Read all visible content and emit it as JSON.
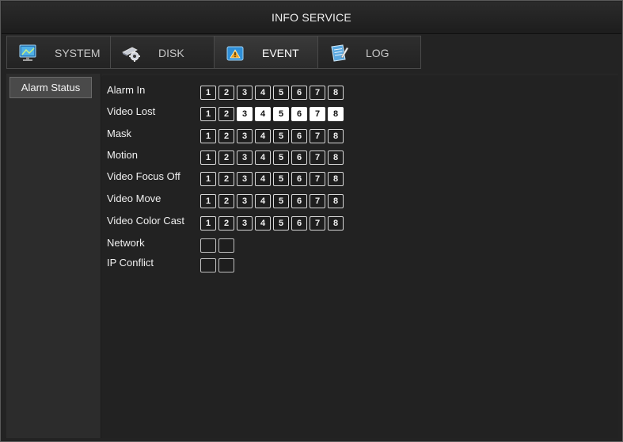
{
  "window": {
    "title": "INFO SERVICE"
  },
  "tabs": [
    {
      "label": "SYSTEM",
      "icon": "monitor-icon",
      "active": false
    },
    {
      "label": "DISK",
      "icon": "disk-gear-icon",
      "active": false
    },
    {
      "label": "EVENT",
      "icon": "warning-icon",
      "active": true
    },
    {
      "label": "LOG",
      "icon": "notepad-icon",
      "active": false
    }
  ],
  "sidebar": {
    "items": [
      {
        "label": "Alarm Status",
        "selected": true
      }
    ]
  },
  "alarm_status": {
    "rows": [
      {
        "label": "Alarm In",
        "channels": [
          "1",
          "2",
          "3",
          "4",
          "5",
          "6",
          "7",
          "8"
        ],
        "active": []
      },
      {
        "label": "Video Lost",
        "channels": [
          "1",
          "2",
          "3",
          "4",
          "5",
          "6",
          "7",
          "8"
        ],
        "active": [
          "3",
          "4",
          "5",
          "6",
          "7",
          "8"
        ]
      },
      {
        "label": "Mask",
        "channels": [
          "1",
          "2",
          "3",
          "4",
          "5",
          "6",
          "7",
          "8"
        ],
        "active": []
      },
      {
        "label": "Motion",
        "channels": [
          "1",
          "2",
          "3",
          "4",
          "5",
          "6",
          "7",
          "8"
        ],
        "active": []
      },
      {
        "label": "Video Focus Off",
        "channels": [
          "1",
          "2",
          "3",
          "4",
          "5",
          "6",
          "7",
          "8"
        ],
        "active": []
      },
      {
        "label": "Video Move",
        "channels": [
          "1",
          "2",
          "3",
          "4",
          "5",
          "6",
          "7",
          "8"
        ],
        "active": []
      },
      {
        "label": "Video Color Cast",
        "channels": [
          "1",
          "2",
          "3",
          "4",
          "5",
          "6",
          "7",
          "8"
        ],
        "active": []
      },
      {
        "label": "Network",
        "channels": [
          "",
          ""
        ],
        "active": []
      },
      {
        "label": "IP Conflict",
        "channels": [
          "",
          ""
        ],
        "active": []
      }
    ]
  },
  "colors": {
    "active_box": "#ffffff",
    "warning_icon": "#f0a020"
  }
}
